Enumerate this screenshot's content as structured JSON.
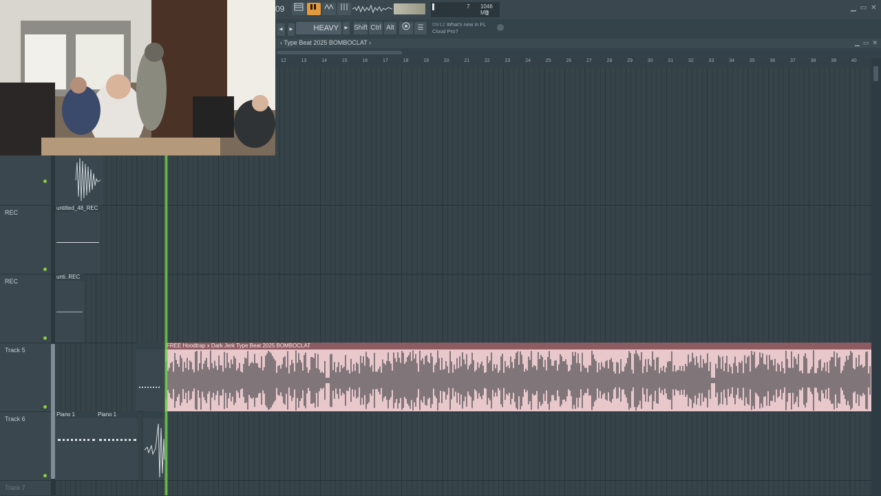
{
  "colors": {
    "accent": "#e39a3e",
    "playhead": "#6fd04a",
    "clip": "#e9c8cc",
    "clip_header": "#8c5c62",
    "led": "#8bcf3f"
  },
  "toolbar": {
    "version_label": "09",
    "icons": [
      "playlist-icon",
      "piano-roll-icon",
      "channel-rack-icon",
      "mixer-icon"
    ],
    "pattern_name": "HEAVY",
    "modifiers": [
      "Shift",
      "Ctrl",
      "Alt"
    ],
    "cpu_value": "7",
    "memory_value": "1046 MB",
    "poly_value": "2",
    "news_date": "09/12",
    "news_text": "What's new in FL Cloud Pro?"
  },
  "playlist": {
    "title": "Type Beat 2025 BOMBOCLAT",
    "ruler": [
      "12",
      "13",
      "14",
      "15",
      "16",
      "17",
      "18",
      "19",
      "20",
      "21",
      "22",
      "23",
      "24",
      "25",
      "26",
      "27",
      "28",
      "29",
      "30",
      "31",
      "32",
      "33",
      "34",
      "35",
      "36",
      "37",
      "38",
      "39",
      "40"
    ]
  },
  "tracks": [
    {
      "name": ""
    },
    {
      "name": "REC"
    },
    {
      "name": "REC"
    },
    {
      "name": "Track 5"
    },
    {
      "name": "Track 6"
    },
    {
      "name": "Track 7"
    }
  ],
  "clips": {
    "rec1": "untitled_48_REC",
    "rec2": "unti..REC",
    "main": "FREE Hoodtrap x Dark Jerk Type Beat 2025 BOMBOCLAT",
    "piano_a": "Piano 1",
    "piano_b": "Piano 1"
  }
}
